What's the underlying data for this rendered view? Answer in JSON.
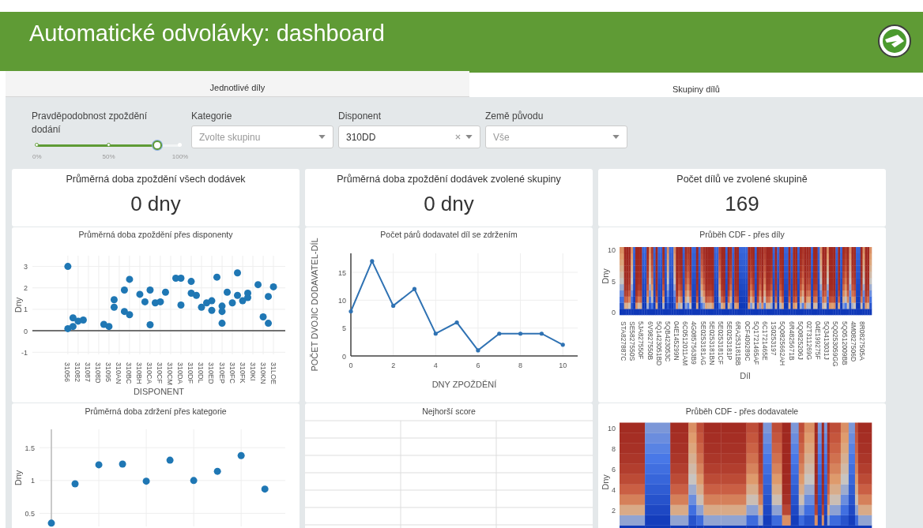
{
  "header": {
    "title": "Automatické odvolávky: dashboard"
  },
  "tabs": [
    {
      "label": "Jednotlivé díly",
      "selected": false
    },
    {
      "label": "Skupiny dílů",
      "selected": true
    }
  ],
  "filters": {
    "slider": {
      "label": "Pravděpodobnost zpoždění dodání",
      "level": 0.84,
      "marks": [
        "0%",
        "50%",
        "100%"
      ]
    },
    "dropdowns": [
      {
        "label": "Kategorie",
        "placeholder": "Zvolte skupinu"
      },
      {
        "label": "Disponent",
        "value": "310DD",
        "clearable": true
      },
      {
        "label": "Země původu",
        "placeholder": "Vše"
      }
    ]
  },
  "kpis": [
    {
      "title": "Průměrná doba zpoždění všech dodávek",
      "value": "0 dny"
    },
    {
      "title": "Průměrná doba zpoždění dodávek zvolené skupiny",
      "value": "0 dny"
    },
    {
      "title": "Počet dílů ve zvolené skupině",
      "value": "169"
    }
  ],
  "charts": [
    {
      "kind": "bubble",
      "title": "Průměrná doba zpoždění přes disponenty",
      "chart_data": {
        "type": "scatter",
        "xlabel": "DISPONENT",
        "ylabel": "Dny",
        "grid": true,
        "ylim": [
          -1.1,
          3.5
        ],
        "yticks": [
          -1,
          0,
          1,
          2,
          3
        ],
        "categories": [
          "31056",
          null,
          "31082",
          null,
          "31087",
          null,
          "3108D",
          null,
          "31095",
          null,
          "310AN",
          null,
          "310BC",
          null,
          "310BH",
          null,
          "310CA",
          null,
          "310CF",
          null,
          "310CM",
          null,
          "310DA",
          null,
          "310DF",
          null,
          "310DL",
          null,
          "310ED",
          null,
          "310EP",
          null,
          "310FC",
          null,
          "310FK",
          null,
          "310KI",
          null,
          "310KN",
          null,
          "31LOE"
        ],
        "series": [
          {
            "color": "#1f77b4",
            "values": [
              3,
              0.2,
              0.45,
              0.5,
              null,
              null,
              null,
              0.3,
              0.2,
              1.45,
              null,
              1.9,
              0.75,
              null,
              1.7,
              1.35,
              1.9,
              1.3,
              1.35,
              1.8,
              null,
              2.45,
              1.2,
              null,
              2.3,
              1.65,
              1.1,
              1.3,
              0.95,
              2.5,
              0.9,
              1.8,
              1.3,
              1.65,
              1.4,
              1.55,
              null,
              2.15,
              0.65,
              1.6,
              2.05
            ]
          },
          {
            "color": "#1f77b4",
            "values": [
              0.1,
              0.6,
              null,
              null,
              null,
              null,
              null,
              null,
              null,
              1.1,
              null,
              0.9,
              2.4,
              null,
              null,
              null,
              0.28,
              null,
              null,
              null,
              null,
              null,
              2.45,
              null,
              1.75,
              null,
              null,
              null,
              1.4,
              null,
              1.15,
              null,
              null,
              2.7,
              null,
              1.75,
              null,
              null,
              null,
              0.35,
              null
            ]
          },
          {
            "color": "#1f77b4",
            "values": [
              null,
              null,
              null,
              null,
              null,
              null,
              null,
              null,
              null,
              null,
              null,
              null,
              null,
              null,
              null,
              null,
              null,
              null,
              null,
              null,
              null,
              null,
              null,
              null,
              null,
              null,
              null,
              null,
              null,
              null,
              0.35,
              null,
              null,
              null,
              null,
              null,
              null,
              null,
              null,
              null,
              null
            ]
          }
        ]
      }
    },
    {
      "kind": "line",
      "title": "Počet párů dodavatel díl se zdržením",
      "chart_data": {
        "type": "line",
        "xlabel": "DNY ZPOŽDĚNÍ",
        "ylabel": "POČET DVOJIC DODAVATEL-DÍL",
        "grid": true,
        "xlim": [
          0,
          10.7
        ],
        "ylim": [
          0,
          18.4
        ],
        "xticks": [
          0,
          2,
          4,
          6,
          8,
          10
        ],
        "yticks": [
          0,
          5,
          10,
          15
        ],
        "x": [
          0,
          1,
          2,
          3,
          4,
          5,
          6,
          7,
          8,
          9,
          10
        ],
        "series": [
          {
            "color": "#2f72b3",
            "values": [
              8,
              17,
              9,
              12,
              4,
              6,
              1,
              4,
              4,
              4,
              2
            ]
          }
        ]
      }
    },
    {
      "kind": "heatmap",
      "title": "Průběh CDF - přes díly",
      "ylabel": "Dny",
      "xlabel": "Díl",
      "yticks": [
        "10",
        "5",
        "0"
      ],
      "xlabels": [
        "STA827887C",
        "SE5827550S",
        "5JA827550F",
        "6V9827550B",
        "5Q1423051BD",
        "5QB423053C",
        "04E145299N",
        "6C0512011AM",
        "4G0857563B9",
        "5E0253181AG",
        "5E0253181BN",
        "5E0253181CF",
        "5E0253181P",
        "6RA253181BB",
        "0CF409289C",
        "5Q1721465AF",
        "6C1721465E",
        "1S0253197",
        "5Q0825662AH",
        "6R4825671B",
        "5Q0825206J",
        "02T311269G",
        "04E199275F",
        "5Q3413031J",
        "5Q0253059GG",
        "5Q0512009BB",
        "4M0827506D",
        "8R0827505A"
      ]
    },
    {
      "kind": "bubble",
      "title": "Průměrná doba zdržení přes kategorie",
      "chart_data": {
        "type": "scatter",
        "ylabel": "Dny",
        "grid": true,
        "ylim": [
          0.3,
          1.78
        ],
        "yticks": [
          0.5,
          1,
          1.5
        ],
        "categories": [
          null,
          null,
          null,
          null,
          null,
          null,
          null,
          null,
          null,
          null
        ],
        "series": [
          {
            "color": "#1f77b4",
            "values": [
              0.35,
              0.95,
              1.24,
              1.25,
              0.99,
              1.31,
              1.0,
              1.14,
              1.38,
              0.87
            ]
          }
        ]
      }
    },
    {
      "kind": "table",
      "title": "Nejhorší score"
    },
    {
      "kind": "heatmap",
      "title": "Průběh CDF - přes dodavatele",
      "ylabel": "Dny",
      "yticks": [
        "10",
        "8",
        "6",
        "4",
        "2"
      ]
    }
  ]
}
